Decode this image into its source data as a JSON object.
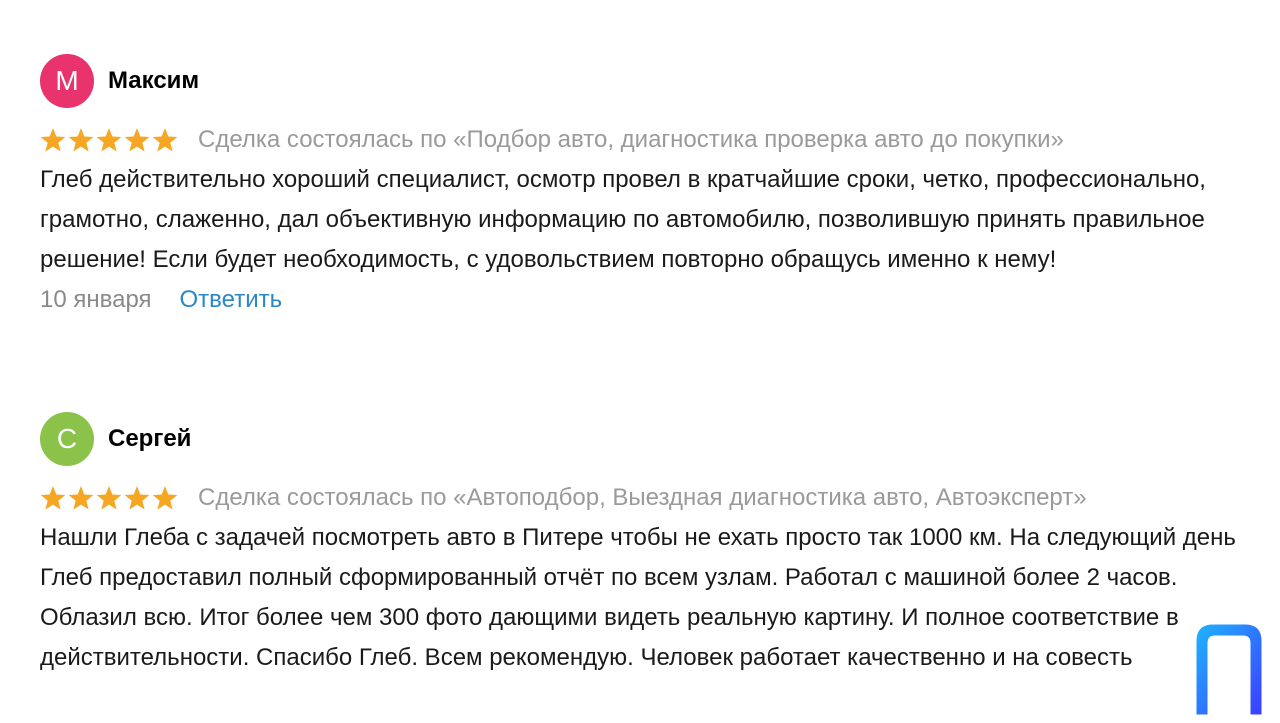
{
  "reviews": [
    {
      "author": {
        "initial": "М",
        "name": "Максим",
        "avatar_color": "#e8336d"
      },
      "rating": 5,
      "deal": "Сделка состоялась по «Подбор авто, диагностика проверка авто до покупки»",
      "text": "Глеб действительно хороший специалист, осмотр провел в кратчайшие сроки, четко, профессионально, грамотно, слаженно, дал объективную информацию по автомобилю, позволившую принять правильное решение! Если будет необходимость, с удовольствием повторно обращусь именно к нему!",
      "date": "10 января",
      "reply_label": "Ответить"
    },
    {
      "author": {
        "initial": "С",
        "name": "Сергей",
        "avatar_color": "#8bc34a"
      },
      "rating": 5,
      "deal": "Сделка состоялась по «Автоподбор, Выездная диагностика авто, Автоэксперт»",
      "text": "Нашли Глеба с задачей посмотреть авто в Питере чтобы не ехать просто так 1000 км. На следующий день Глеб предоставил полный сформированный отчёт по всем узлам. Работал с машиной более 2 часов. Облазил всю. Итог более чем 300 фото дающими видеть реальную картину. И полное соответствие в действительности. Спасибо Глеб. Всем рекомендую. Человек работает качественно и на совесть"
    }
  ],
  "colors": {
    "star": "#f5a623",
    "link": "#2a88c8",
    "muted": "#9a9a9a",
    "logo_gradient_start": "#1fb6ff",
    "logo_gradient_end": "#3b3bff"
  },
  "icons": {
    "star": "star-icon",
    "logo": "corner-logo-icon"
  }
}
